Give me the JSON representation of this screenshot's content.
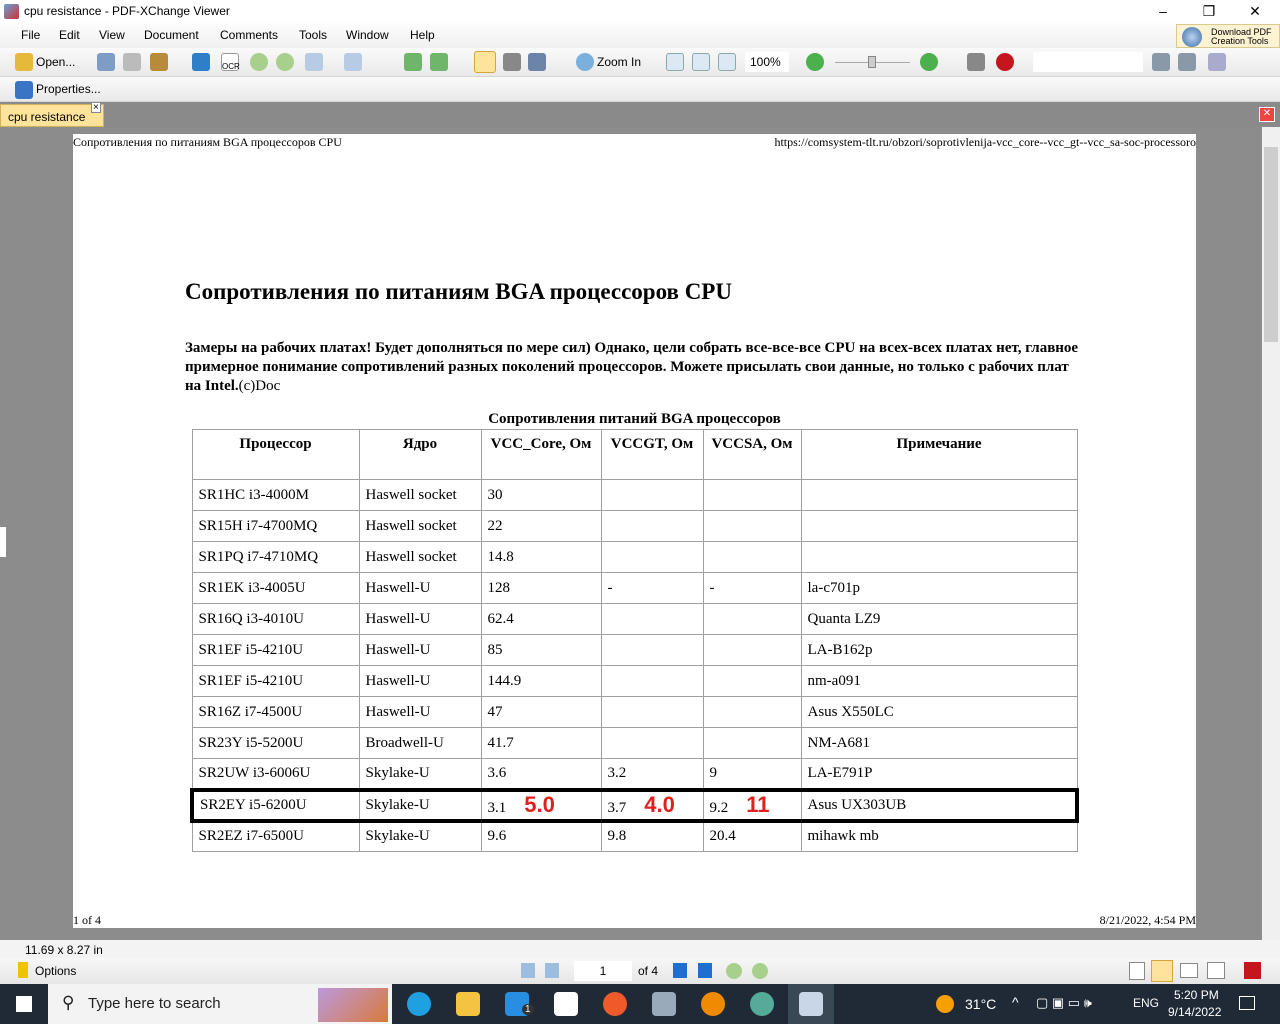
{
  "window": {
    "title": "cpu resistance - PDF-XChange Viewer",
    "minimize": "–",
    "restore": "❐",
    "close": "✕"
  },
  "menu": [
    "File",
    "Edit",
    "View",
    "Document",
    "Comments",
    "Tools",
    "Window",
    "Help"
  ],
  "toolbar": {
    "open": "Open...",
    "ocr": "OCR",
    "zoom_in": "Zoom In",
    "zoom_value": "100%",
    "properties": "Properties...",
    "download_pdf": "Download PDF",
    "creation_tools": "Creation Tools",
    "search_value": ""
  },
  "tab": {
    "label": "cpu resistance",
    "close": "×"
  },
  "page": {
    "header_left": "Сопротивления по питаниям BGA процессоров CPU",
    "header_right": "https://comsystem-tlt.ru/obzori/soprotivlenija-vcc_core--vcc_gt--vcc_sa-soc-processoro",
    "title": "Сопротивления по питаниям BGA процессоров CPU",
    "intro_bold": "Замеры на рабочих платах! Будет дополняться по мере сил) Однако, цели собрать все-все-все CPU на всех-всех платах нет, главное примерное понимание сопротивлений разных поколений процессоров. Можете присылать свои данные, но только с рабочих плат на Intel.",
    "intro_tail": "(c)Doc",
    "table_caption": "Сопротивления питаний BGA процессоров",
    "columns": [
      "Процессор",
      "Ядро",
      "VCC_Core, Ом",
      "VCCGT, Ом",
      "VCCSA, Ом",
      "Примечание"
    ],
    "rows": [
      [
        "SR1HC i3-4000M",
        "Haswell socket",
        "30",
        "",
        "",
        ""
      ],
      [
        "SR15H i7-4700MQ",
        "Haswell socket",
        "22",
        "",
        "",
        ""
      ],
      [
        "SR1PQ i7-4710MQ",
        "Haswell socket",
        "14.8",
        "",
        "",
        ""
      ],
      [
        "SR1EK i3-4005U",
        "Haswell-U",
        "128",
        "-",
        "-",
        "la-c701p"
      ],
      [
        "SR16Q i3-4010U",
        "Haswell-U",
        "62.4",
        "",
        "",
        "Quanta LZ9"
      ],
      [
        "SR1EF i5-4210U",
        "Haswell-U",
        "85",
        "",
        "",
        "LA-B162p"
      ],
      [
        "SR1EF i5-4210U",
        "Haswell-U",
        "144.9",
        "",
        "",
        "nm-a091"
      ],
      [
        "SR16Z i7-4500U",
        "Haswell-U",
        "47",
        "",
        "",
        "Asus X550LC"
      ],
      [
        "SR23Y i5-5200U",
        "Broadwell-U",
        "41.7",
        "",
        "",
        "NM-A681"
      ],
      [
        "SR2UW i3-6006U",
        "Skylake-U",
        "3.6",
        "3.2",
        "9",
        "LA-E791P"
      ],
      [
        "SR2EY i5-6200U",
        "Skylake-U",
        "3.1",
        "3.7",
        "9.2",
        "Asus UX303UB"
      ],
      [
        "SR2EZ i7-6500U",
        "Skylake-U",
        "9.6",
        "9.8",
        "20.4",
        "mihawk mb"
      ]
    ],
    "highlighted_row": 10,
    "annotations": [
      "5.0",
      "4.0",
      "11"
    ],
    "footer_left": "1 of 4",
    "footer_right": "8/21/2022, 4:54 PM"
  },
  "status": {
    "page_size": "11.69 x 8.27 in"
  },
  "bottom": {
    "options": "Options",
    "page_input": "1",
    "page_total": "of 4"
  },
  "taskbar": {
    "search_placeholder": "Type here to search",
    "weather": "31°C",
    "lang": "ENG",
    "time": "5:20 PM",
    "date": "9/14/2022",
    "mail_badge": "1"
  },
  "colors": {
    "accent_red": "#e0201c",
    "tab_bg": "#ffe39a",
    "taskbar": "#1f2a36"
  }
}
